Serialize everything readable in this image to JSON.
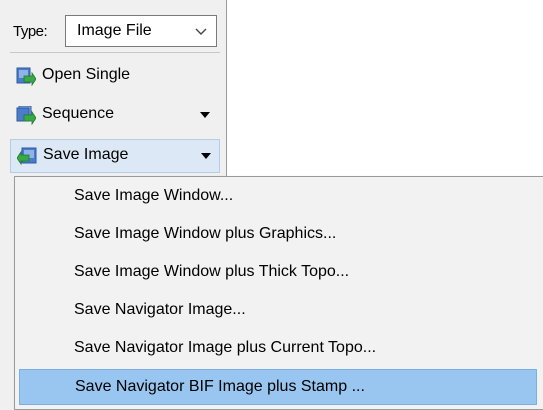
{
  "panel": {
    "type_label": "Type:",
    "type_value": "Image File",
    "buttons": [
      {
        "label": "Open Single",
        "icon": "open-single-icon"
      },
      {
        "label": "Sequence",
        "icon": "sequence-icon",
        "has_dropdown": true
      },
      {
        "label": "Save Image",
        "icon": "save-image-icon",
        "has_dropdown": true,
        "active": true
      }
    ]
  },
  "menu": {
    "items": [
      {
        "label": "Save Image Window..."
      },
      {
        "label": "Save Image Window plus Graphics..."
      },
      {
        "label": "Save Image Window plus Thick Topo..."
      },
      {
        "label": "Save Navigator Image..."
      },
      {
        "label": "Save Navigator Image plus Current Topo..."
      },
      {
        "label": "Save Navigator BIF Image plus Stamp ...",
        "highlighted": true
      }
    ]
  },
  "colors": {
    "panel_bg": "#f0f0f0",
    "menu_bg": "#f2f2f2",
    "highlight": "#99c6f0",
    "active_button": "#dce8f5",
    "icon_green": "#3aa845",
    "icon_blue": "#4a7cc9"
  }
}
